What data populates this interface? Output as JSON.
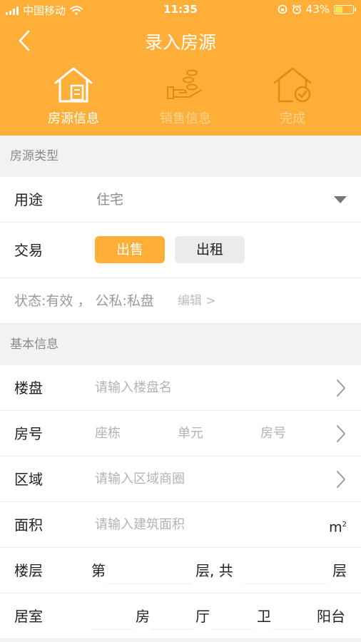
{
  "status_bar": {
    "carrier": "中国移动",
    "time": "11:35",
    "battery": "43%",
    "battery_level": 0.43
  },
  "header": {
    "title": "录入房源"
  },
  "steps": [
    {
      "label": "房源信息",
      "icon": "house-doc-icon",
      "active": true
    },
    {
      "label": "销售信息",
      "icon": "hand-coins-icon",
      "active": false
    },
    {
      "label": "完成",
      "icon": "house-check-icon",
      "active": false
    }
  ],
  "section_type": {
    "title": "房源类型",
    "usage": {
      "label": "用途",
      "value": "住宅"
    },
    "trade": {
      "label": "交易",
      "options": [
        "出售",
        "出租"
      ],
      "selected": "出售"
    },
    "status": {
      "text": "状态:有效 ， 公私:私盘",
      "edit": "编辑 >"
    }
  },
  "section_basic": {
    "title": "基本信息",
    "building": {
      "label": "楼盘",
      "placeholder": "请输入楼盘名"
    },
    "room_no": {
      "label": "房号",
      "placeholders": [
        "座栋",
        "单元",
        "房号"
      ]
    },
    "area": {
      "label": "区域",
      "placeholder": "请输入区域商圈"
    },
    "size": {
      "label": "面积",
      "placeholder": "请输入建筑面积",
      "unit": "m",
      "unit_sup": "2"
    },
    "floor": {
      "label": "楼层",
      "prefix": "第",
      "mid": "层, 共",
      "suffix": "层"
    },
    "rooms": {
      "label": "居室",
      "units": [
        "房",
        "厅",
        "卫",
        "阳台"
      ]
    }
  },
  "colors": {
    "accent": "#FFAE37",
    "background": "#f2f2f2"
  }
}
